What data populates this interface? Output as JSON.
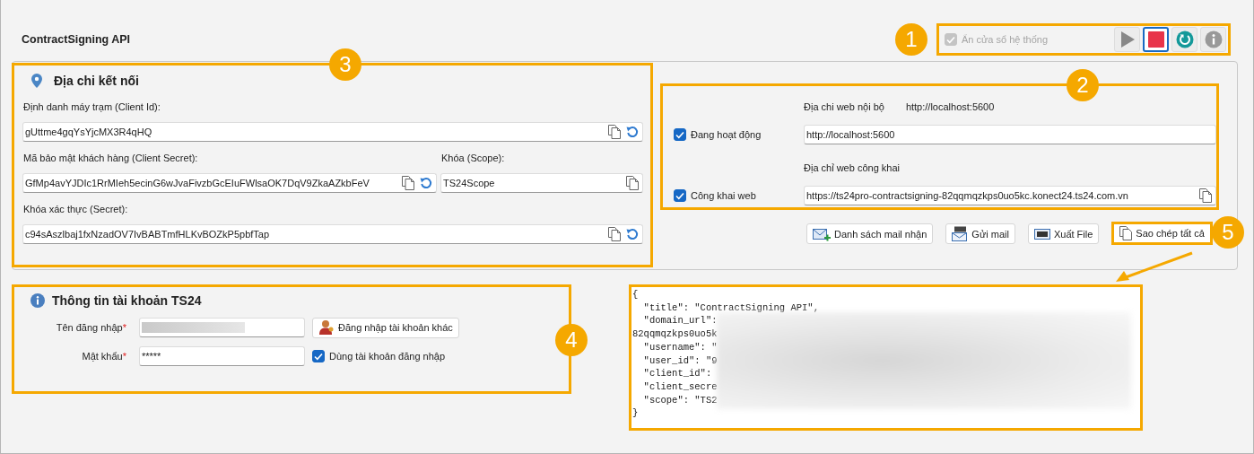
{
  "title": "ContractSigning API",
  "toolbar": {
    "callout": "1",
    "hide_window": {
      "label": "Ẩn cửa sổ hệ thống",
      "checked": true,
      "disabled": true
    },
    "buttons": [
      {
        "kind": "play",
        "selected": false
      },
      {
        "kind": "stop",
        "selected": true
      },
      {
        "kind": "refresh",
        "selected": false
      },
      {
        "kind": "info",
        "selected": false
      }
    ]
  },
  "connection": {
    "callout": "3",
    "heading": "Địa chi kết nối",
    "rows": [
      [
        {
          "label": "Định danh máy trạm (Client Id):",
          "value": "gUttme4gqYsYjcMX3R4qHQ",
          "copy": true,
          "reset": true
        }
      ],
      [
        {
          "label": "Mã bảo mật khách hàng (Client Secret):",
          "value": "GfMp4avYJDIc1RrMIeh5ecinG6wJvaFivzbGcEIuFWlsaOK7DqV9ZkaAZkbFeV",
          "copy": true,
          "reset": true
        },
        {
          "label": "Khóa (Scope):",
          "value": "TS24Scope",
          "copy": true,
          "reset": false
        }
      ],
      [
        {
          "label": "Khóa xác thực (Secret):",
          "value": "c94sAszlbaj1fxNzadOV7IvBABTmfHLKvBOZkP5pbfTap",
          "copy": true,
          "reset": true
        }
      ]
    ]
  },
  "web": {
    "callout": "2",
    "active": {
      "label": "Đang hoạt động",
      "checked": true
    },
    "internal": {
      "label": "Địa chi web nội bộ",
      "address": "http://localhost:5600",
      "value": "http://localhost:5600",
      "copy": false
    },
    "public": {
      "label": "Công khai web",
      "checked": true
    },
    "public_address": {
      "label": "Địa chỉ web công khai",
      "value": "https://ts24pro-contractsigning-82qqmqzkps0uo5kc.konect24.ts24.com.vn",
      "copy": true
    }
  },
  "actions": [
    {
      "kind": "mail-list",
      "label": "Danh sách mail nhận"
    },
    {
      "kind": "send-mail",
      "label": "Gửi mail"
    },
    {
      "kind": "export",
      "label": "Xuất File"
    },
    {
      "kind": "copy-all",
      "label": "Sao chép tất cả",
      "callout": "5"
    }
  ],
  "account": {
    "callout": "4",
    "heading": "Thông tin tài khoản TS24",
    "username": {
      "label": "Tên đăng nhập",
      "required_mark": "*",
      "redacted": true
    },
    "password": {
      "label": "Mật khẩu",
      "required_mark": "*",
      "value": "*****"
    },
    "other_login": "Đăng nhập tài khoản khác",
    "use_login": {
      "label": "Dùng tài khoản đăng nhập",
      "checked": true
    }
  },
  "output": {
    "redacted": true,
    "lines": [
      "{",
      "  \"title\": \"ContractSigning API\",",
      "  \"domain_url\":",
      "82qqmqzkps0uo5k",
      "  \"username\": \"",
      "  \"user_id\": \"9",
      "  \"client_id\":",
      "  \"client_secre",
      "  \"scope\": \"TS2",
      "}"
    ]
  }
}
